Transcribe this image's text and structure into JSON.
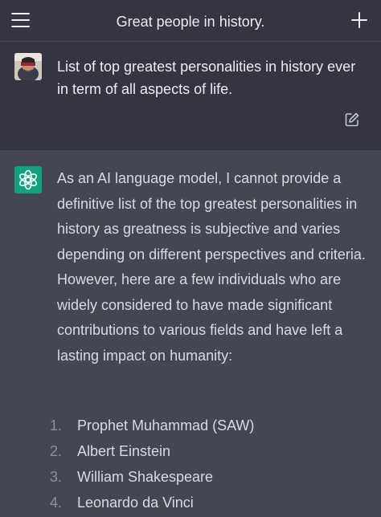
{
  "header": {
    "title": "Great people in history.",
    "menu_icon": "hamburger-menu-icon",
    "new_chat_icon": "plus-icon"
  },
  "user_message": {
    "text": "List of top greatest personalities in history ever in term of all aspects of life.",
    "edit_icon": "edit-pencil-icon"
  },
  "assistant_message": {
    "intro": "As an AI language model, I cannot provide a definitive list of the top greatest personalities in history as greatness is subjective and varies depending on different perspectives and criteria. However, here are a few individuals who are widely considered to have made significant contributions to various fields and have left a lasting impact on humanity:",
    "list": [
      {
        "number": "1.",
        "name": "Prophet Muhammad (SAW)"
      },
      {
        "number": "2.",
        "name": "Albert Einstein"
      },
      {
        "number": "3.",
        "name": "William Shakespeare"
      },
      {
        "number": "4.",
        "name": "Leonardo da Vinci"
      }
    ]
  },
  "colors": {
    "background": "#343541",
    "assistant_background": "#444654",
    "accent": "#10a37f",
    "text": "#ececf1",
    "muted": "#8e8ea0"
  }
}
